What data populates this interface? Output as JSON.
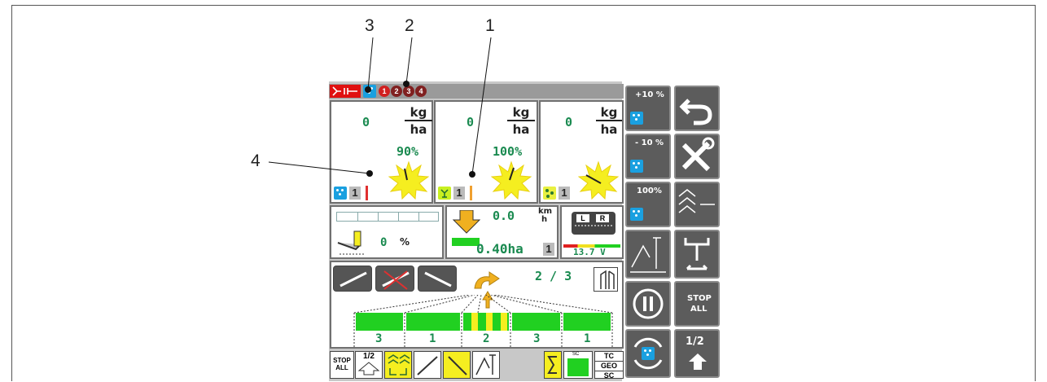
{
  "callouts": {
    "c1": "1",
    "c2": "2",
    "c3": "3",
    "c4": "4"
  },
  "badges": [
    "1",
    "2",
    "3",
    "4"
  ],
  "metering": [
    {
      "rate": "0",
      "unit_top": "kg",
      "unit_bottom": "ha",
      "percent": "90%",
      "count": "1",
      "bar_color": "#e03030"
    },
    {
      "rate": "0",
      "unit_top": "kg",
      "unit_bottom": "ha",
      "percent": "100%",
      "count": "1",
      "bar_color": "#f0a030"
    },
    {
      "rate": "0",
      "unit_top": "kg",
      "unit_bottom": "ha",
      "percent": "",
      "count": "1",
      "bar_color": ""
    }
  ],
  "fill": {
    "value": "0",
    "unit": "%"
  },
  "speed": {
    "value": "0.0",
    "unit_top": "km",
    "unit_bottom": "h",
    "area": "0.40ha",
    "count": "1"
  },
  "voltage": "13.7 V",
  "tramline": {
    "counter": "2 / 3"
  },
  "sections": [
    "3",
    "1",
    "2",
    "3",
    "1"
  ],
  "side_buttons": {
    "plus10": "+10 %",
    "minus10": "- 10 %",
    "p100": "100%",
    "stop_all_1": "STOP",
    "stop_all_2": "ALL",
    "half": "1/2"
  },
  "bottom": {
    "stop_1": "STOP",
    "stop_2": "ALL",
    "half": "1/2",
    "sc": "SC",
    "tc": "TC",
    "geo": "GEO",
    "sc2": "SC"
  },
  "colors": {
    "green_value": "#1a8a50",
    "section_green": "#21d021",
    "sun": "#f5ee20",
    "blue": "#1aa0e0"
  }
}
